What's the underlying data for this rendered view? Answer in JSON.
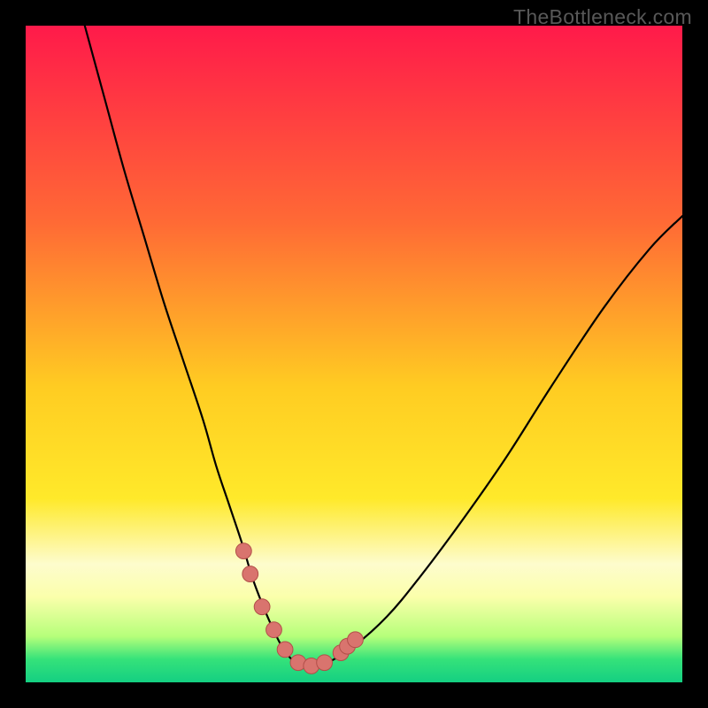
{
  "watermark": "TheBottleneck.com",
  "chart_data": {
    "type": "line",
    "title": "",
    "xlabel": "",
    "ylabel": "",
    "xlim": [
      0,
      100
    ],
    "ylim": [
      0,
      100
    ],
    "gradient_stops": [
      {
        "offset": 0.0,
        "color": "#ff1a4a"
      },
      {
        "offset": 0.3,
        "color": "#ff6a35"
      },
      {
        "offset": 0.55,
        "color": "#ffcc22"
      },
      {
        "offset": 0.72,
        "color": "#ffe92a"
      },
      {
        "offset": 0.82,
        "color": "#fdfccd"
      },
      {
        "offset": 0.87,
        "color": "#fbffab"
      },
      {
        "offset": 0.93,
        "color": "#b6ff7a"
      },
      {
        "offset": 0.965,
        "color": "#35e27a"
      },
      {
        "offset": 1.0,
        "color": "#14cf82"
      }
    ],
    "series": [
      {
        "name": "bottleneck-curve",
        "type": "line",
        "x": [
          9.0,
          12.0,
          15.0,
          18.0,
          21.0,
          24.0,
          27.0,
          29.0,
          31.0,
          33.0,
          34.5,
          36.0,
          37.5,
          39.0,
          40.5,
          42.0,
          44.0,
          46.0,
          50.0,
          55.0,
          60.0,
          66.0,
          73.0,
          80.0,
          88.0,
          95.0,
          100.0
        ],
        "y": [
          100.0,
          89.0,
          78.0,
          68.0,
          58.0,
          49.0,
          40.0,
          33.0,
          27.0,
          21.0,
          16.0,
          12.0,
          8.5,
          5.5,
          3.5,
          2.5,
          2.5,
          3.0,
          5.5,
          10.0,
          16.0,
          24.0,
          34.0,
          45.0,
          57.0,
          66.0,
          71.0
        ]
      },
      {
        "name": "marker-points",
        "type": "scatter",
        "x": [
          33.2,
          34.2,
          36.0,
          37.8,
          39.5,
          41.5,
          43.5,
          45.5,
          48.0,
          49.0,
          50.2
        ],
        "y": [
          20.0,
          16.5,
          11.5,
          8.0,
          5.0,
          3.0,
          2.5,
          3.0,
          4.5,
          5.5,
          6.5
        ]
      }
    ],
    "marker_style": {
      "fill": "#d9746e",
      "stroke": "#b24f49",
      "radius_frac": 0.012
    }
  }
}
